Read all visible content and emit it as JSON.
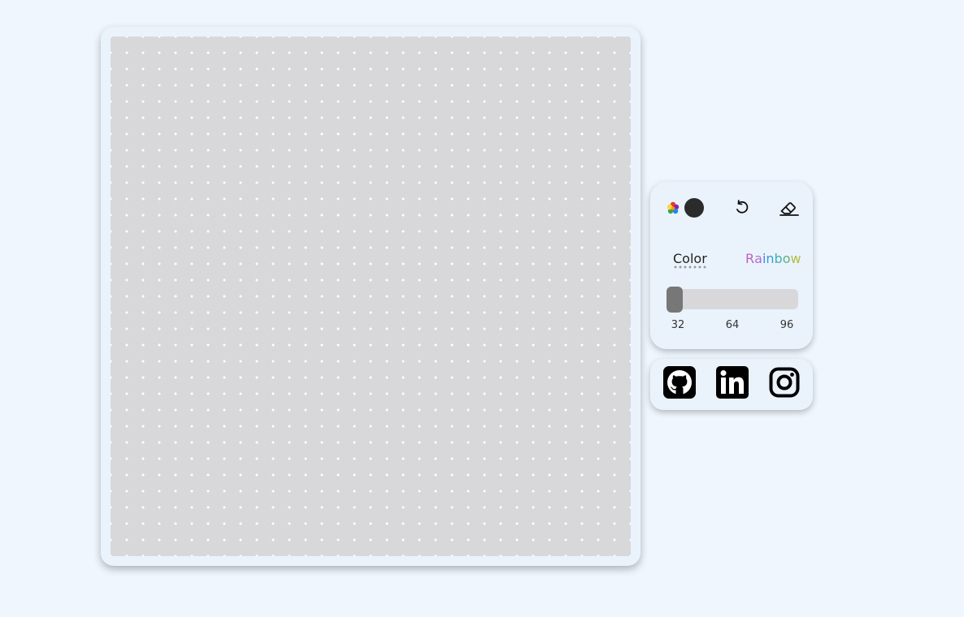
{
  "toolbar": {
    "palette_icon": "color-palette-icon",
    "current_color": "#2b2b2b",
    "undo_icon": "undo-icon",
    "eraser_icon": "eraser-icon"
  },
  "mode": {
    "color_label": "Color",
    "rainbow_label": "Rainbow",
    "rainbow_letters": [
      "R",
      "a",
      "i",
      "n",
      "b",
      "o",
      "w"
    ],
    "rainbow_colors": [
      "#c060c0",
      "#b070d0",
      "#5080e0",
      "#30a0d0",
      "#40b0b0",
      "#60b080",
      "#b0c040"
    ],
    "selected": "Color"
  },
  "grid_size": {
    "ticks": [
      "32",
      "64",
      "96"
    ],
    "value": 32
  },
  "social": {
    "github_icon": "github-icon",
    "linkedin_icon": "linkedin-icon",
    "instagram_icon": "instagram-icon"
  },
  "colors": {
    "background": "#eff6fe",
    "canvas": "#d8d8da",
    "panel": "#eaf3fc"
  }
}
